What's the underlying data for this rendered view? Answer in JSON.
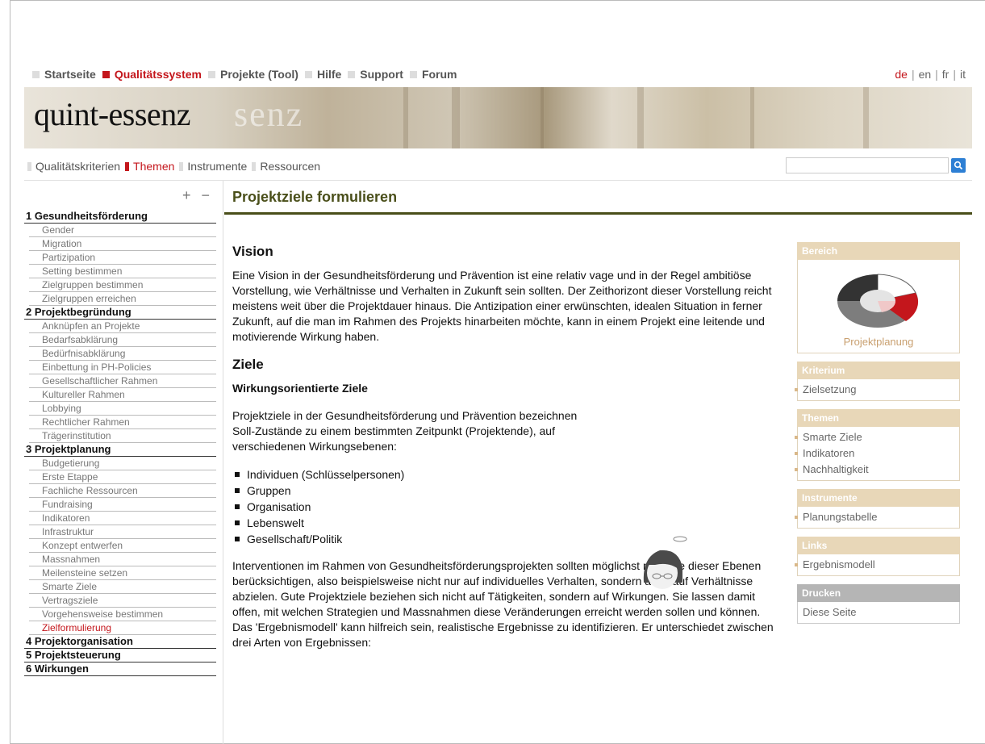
{
  "topnav": {
    "items": [
      {
        "label": "Startseite",
        "active": false
      },
      {
        "label": "Qualitätssystem",
        "active": true
      },
      {
        "label": "Projekte (Tool)",
        "active": false
      },
      {
        "label": "Hilfe",
        "active": false
      },
      {
        "label": "Support",
        "active": false
      },
      {
        "label": "Forum",
        "active": false
      }
    ],
    "languages": [
      {
        "label": "de",
        "active": true
      },
      {
        "label": "en",
        "active": false
      },
      {
        "label": "fr",
        "active": false
      },
      {
        "label": "it",
        "active": false
      }
    ]
  },
  "banner": {
    "logo": "quint-essenz",
    "ghost": "senz"
  },
  "subnav": {
    "items": [
      {
        "label": "Qualitätskriterien",
        "active": false
      },
      {
        "label": "Themen",
        "active": true
      },
      {
        "label": "Instrumente",
        "active": false
      },
      {
        "label": "Ressourcen",
        "active": false
      }
    ],
    "search_placeholder": ""
  },
  "sidebar": {
    "expand_collapse": "+ −",
    "sections": [
      {
        "title": "1 Gesundheitsförderung",
        "items": [
          "Gender",
          "Migration",
          "Partizipation",
          "Setting bestimmen",
          "Zielgruppen bestimmen",
          "Zielgruppen erreichen"
        ]
      },
      {
        "title": "2 Projektbegründung",
        "items": [
          "Anknüpfen an Projekte",
          "Bedarfsabklärung",
          "Bedürfnisabklärung",
          "Einbettung in PH-Policies",
          "Gesellschaftlicher Rahmen",
          "Kultureller Rahmen",
          "Lobbying",
          "Rechtlicher Rahmen",
          "Trägerinstitution"
        ]
      },
      {
        "title": "3 Projektplanung",
        "items": [
          "Budgetierung",
          "Erste Etappe",
          "Fachliche Ressourcen",
          "Fundraising",
          "Indikatoren",
          "Infrastruktur",
          "Konzept entwerfen",
          "Massnahmen",
          "Meilensteine setzen",
          "Smarte Ziele",
          "Vertragsziele",
          "Vorgehensweise bestimmen",
          "Zielformulierung"
        ]
      },
      {
        "title": "4 Projektorganisation",
        "items": []
      },
      {
        "title": "5 Projektsteuerung",
        "items": []
      },
      {
        "title": "6 Wirkungen",
        "items": []
      }
    ],
    "active_item": "Zielformulierung"
  },
  "main": {
    "title": "Projektziele formulieren",
    "vision_heading": "Vision",
    "vision_text": "Eine Vision in der Gesundheitsförderung und Prävention ist eine relativ vage und in der Regel ambitiöse Vorstellung, wie Verhältnisse und Verhalten in Zukunft sein sollten. Der Zeithorizont dieser Vorstellung reicht meistens weit über die Projektdauer hinaus. Die Antizipation einer erwünschten, idealen Situation in ferner Zukunft, auf die man im Rahmen des Projekts hinarbeiten möchte, kann in einem Projekt eine leitende und motivierende Wirkung haben.",
    "ziele_heading": "Ziele",
    "wirkung_heading": "Wirkungsorientierte Ziele",
    "wirkung_text": "Projektziele in der Gesundheitsförderung und Prävention bezeichnen Soll-Zustände zu einem bestimmten Zeitpunkt (Projektende), auf verschiedenen Wirkungsebenen:",
    "levels": [
      "Individuen (Schlüsselpersonen)",
      "Gruppen",
      "Organisation",
      "Lebenswelt",
      "Gesellschaft/Politik"
    ],
    "interventions_text": "Interventionen im Rahmen von Gesundheitsförderungsprojekten sollten möglichst mehrere dieser Ebenen berücksichtigen, also beispielsweise nicht nur auf individuelles Verhalten, sondern auch auf Verhältnisse abzielen. Gute Projektziele beziehen sich nicht auf Tätigkeiten, sondern auf Wirkungen. Sie lassen damit offen, mit welchen Strategien und Massnahmen diese Veränderungen erreicht werden sollen und können. Das 'Ergebnismodell' kann hilfreich sein, realistische Ergebnisse zu identifizieren. Er unterschiedet zwischen drei Arten von Ergebnissen:"
  },
  "right": {
    "bereich": {
      "header": "Bereich",
      "caption": "Projektplanung"
    },
    "kriterium": {
      "header": "Kriterium",
      "items": [
        "Zielsetzung"
      ]
    },
    "themen": {
      "header": "Themen",
      "items": [
        "Smarte Ziele",
        "Indikatoren",
        "Nachhaltigkeit"
      ]
    },
    "instrumente": {
      "header": "Instrumente",
      "items": [
        "Planungstabelle"
      ]
    },
    "links": {
      "header": "Links",
      "items": [
        "Ergebnismodell"
      ]
    },
    "drucken": {
      "header": "Drucken",
      "items": [
        "Diese Seite"
      ]
    }
  },
  "colors": {
    "accent": "#c4161c",
    "title": "#4a4f1a",
    "box_header": "#e8d7b8"
  }
}
